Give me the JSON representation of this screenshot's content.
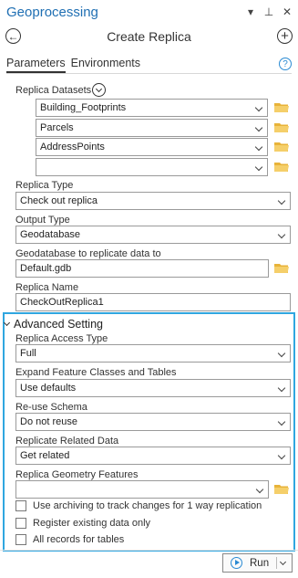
{
  "titlebar": {
    "title": "Geoprocessing",
    "dropdown_glyph": "▾",
    "pin_glyph": "⊥",
    "close_glyph": "✕"
  },
  "header": {
    "tool_title": "Create Replica",
    "back_glyph": "←",
    "add_glyph": "+"
  },
  "tabs": [
    {
      "label": "Parameters",
      "active": true
    },
    {
      "label": "Environments",
      "active": false
    }
  ],
  "help_glyph": "?",
  "params": {
    "replica_datasets": {
      "label": "Replica Datasets",
      "values": [
        "Building_Footprints",
        "Parcels",
        "AddressPoints",
        ""
      ]
    },
    "replica_type": {
      "label": "Replica Type",
      "value": "Check out replica"
    },
    "output_type": {
      "label": "Output Type",
      "value": "Geodatabase"
    },
    "geodatabase": {
      "label": "Geodatabase to replicate data to",
      "value": "Default.gdb"
    },
    "replica_name": {
      "label": "Replica Name",
      "value": "CheckOutReplica1"
    }
  },
  "advanced": {
    "heading": "Advanced Setting",
    "access_type": {
      "label": "Replica Access Type",
      "value": "Full"
    },
    "expand_feature": {
      "label": "Expand Feature Classes and Tables",
      "value": "Use defaults"
    },
    "reuse_schema": {
      "label": "Re-use Schema",
      "value": "Do not reuse"
    },
    "related_data": {
      "label": "Replicate Related Data",
      "value": "Get related"
    },
    "geometry_features": {
      "label": "Replica Geometry Features",
      "value": ""
    },
    "checkboxes": [
      {
        "label": "Use archiving to track changes for 1 way replication",
        "checked": false
      },
      {
        "label": "Register existing data only",
        "checked": false
      },
      {
        "label": "All records for tables",
        "checked": false
      }
    ]
  },
  "run_button": {
    "label": "Run"
  },
  "colors": {
    "title_blue": "#1f6fb3",
    "highlight_border": "#2fa6e0",
    "folder_yellow": "#e8b339",
    "icon_blue": "#2a8ad3"
  }
}
